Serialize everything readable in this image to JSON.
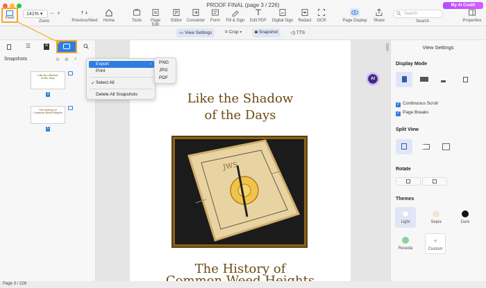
{
  "window": {
    "title": "PROOF FINAL (page 3 / 226)",
    "traffic_colors": [
      "#ff5f57",
      "#febc2e",
      "#28c840"
    ]
  },
  "toolbar": {
    "panel": "Panel",
    "zoom_value": "141%",
    "zoom": "Zoom",
    "prev_next": "Previous/Next",
    "home": "Home",
    "tools": "Tools",
    "page_edit": "Page Edit",
    "editor": "Editor",
    "converter": "Converter",
    "form": "Form",
    "fill_sign": "Fill & Sign",
    "edit_pdf": "Edit PDF",
    "digital_sign": "Digital Sign",
    "redact": "Redact",
    "ocr": "OCR",
    "page_display": "Page Display",
    "share": "Share",
    "search": "Search",
    "search_placeholder": "Search",
    "properties": "Properties",
    "ai_credit": "My AI Credit"
  },
  "subbar": {
    "view_settings": "View Settings",
    "crop": "Crop",
    "snapshot": "Snapshot",
    "tts": "TTS"
  },
  "sidebar": {
    "title": "Snapshots",
    "thumb1_lines": [
      "Like the Shadow",
      "of the Days"
    ],
    "thumb2_lines": [
      "The History of",
      "Common Weed Heights"
    ],
    "thumb1_page": "3",
    "thumb2_page": "5"
  },
  "context_menu": {
    "export": "Export",
    "print": "Print",
    "select_all": "Select All",
    "select_all_check": "✓",
    "delete_all": "Delete All Snapshots",
    "submenu": [
      "PNG",
      "JPG",
      "PDF"
    ]
  },
  "document": {
    "title_line1": "Like the Shadow",
    "title_line2": "of the Days",
    "footer_line1": "The History of",
    "footer_line2": "Common Weed Heights",
    "ai_badge": "AI"
  },
  "right_panel": {
    "title": "View Settings",
    "display_mode": "Display Mode",
    "continuous_scroll": "Continuous Scroll",
    "page_breaks": "Page Breaks",
    "split_view": "Split View",
    "rotate": "Rotate",
    "themes": "Themes",
    "theme_list": [
      {
        "label": "Light",
        "color": "#ffffff"
      },
      {
        "label": "Sepia",
        "color": "#f1e4d3"
      },
      {
        "label": "Dark",
        "color": "#111111"
      },
      {
        "label": "Reseda",
        "color": "#8fcf9a"
      },
      {
        "label": "Custom",
        "color": "#ffffff"
      }
    ]
  },
  "status": {
    "page": "Page 3 / 226"
  },
  "colors": {
    "accent": "#2f7de1",
    "highlight_outline": "#f5a623",
    "heading": "#6b4a12",
    "ai": "#7a3ff2"
  }
}
